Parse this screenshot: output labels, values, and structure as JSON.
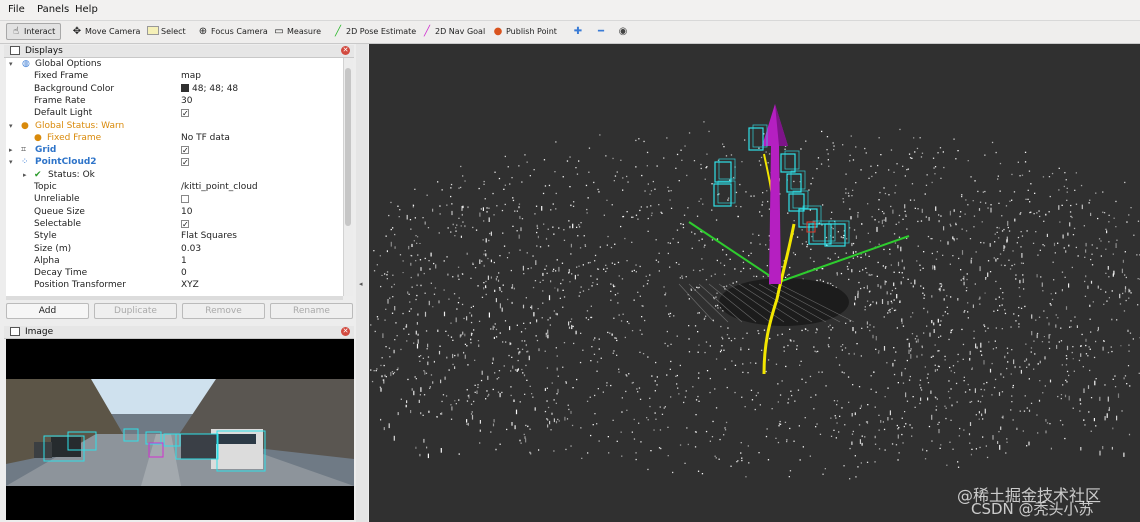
{
  "menu": [
    "File",
    "Panels",
    "Help"
  ],
  "toolbar": [
    {
      "label": "Interact",
      "icon": "interact-icon"
    },
    {
      "label": "Move Camera",
      "icon": "move-camera-icon"
    },
    {
      "label": "Select",
      "icon": "select-icon"
    },
    {
      "label": "Focus Camera",
      "icon": "focus-camera-icon"
    },
    {
      "label": "Measure",
      "icon": "measure-icon"
    },
    {
      "label": "2D Pose Estimate",
      "icon": "pose-estimate-icon"
    },
    {
      "label": "2D Nav Goal",
      "icon": "nav-goal-icon"
    },
    {
      "label": "Publish Point",
      "icon": "publish-point-icon"
    }
  ],
  "displays": {
    "title": "Displays",
    "rows": {
      "global_options": "Global Options",
      "fixed_frame_k": "Fixed Frame",
      "fixed_frame_v": "map",
      "bg_color_k": "Background Color",
      "bg_color_v": "48; 48; 48",
      "frame_rate_k": "Frame Rate",
      "frame_rate_v": "30",
      "default_light_k": "Default Light",
      "global_status": "Global Status: Warn",
      "fixed_frame_warn_k": "Fixed Frame",
      "fixed_frame_warn_v": "No TF data",
      "grid": "Grid",
      "pointcloud": "PointCloud2",
      "status_ok": "Status: Ok",
      "topic_k": "Topic",
      "topic_v": "/kitti_point_cloud",
      "unreliable_k": "Unreliable",
      "queue_k": "Queue Size",
      "queue_v": "10",
      "selectable_k": "Selectable",
      "style_k": "Style",
      "style_v": "Flat Squares",
      "size_k": "Size (m)",
      "size_v": "0.03",
      "alpha_k": "Alpha",
      "alpha_v": "1",
      "decay_k": "Decay Time",
      "decay_v": "0",
      "pos_k": "Position Transformer",
      "pos_v": "XYZ"
    },
    "buttons": {
      "add": "Add",
      "duplicate": "Duplicate",
      "remove": "Remove",
      "rename": "Rename"
    }
  },
  "image_panel": {
    "title": "Image"
  },
  "watermark": {
    "line1": "@稀土掘金技术社区",
    "line2": "CSDN @秃头小苏"
  },
  "colors": {
    "background": "#303030",
    "arrow": "#b51fc1",
    "path": "#f2e600",
    "axis": "#2ecc2e",
    "box": "#2fe0e8"
  }
}
